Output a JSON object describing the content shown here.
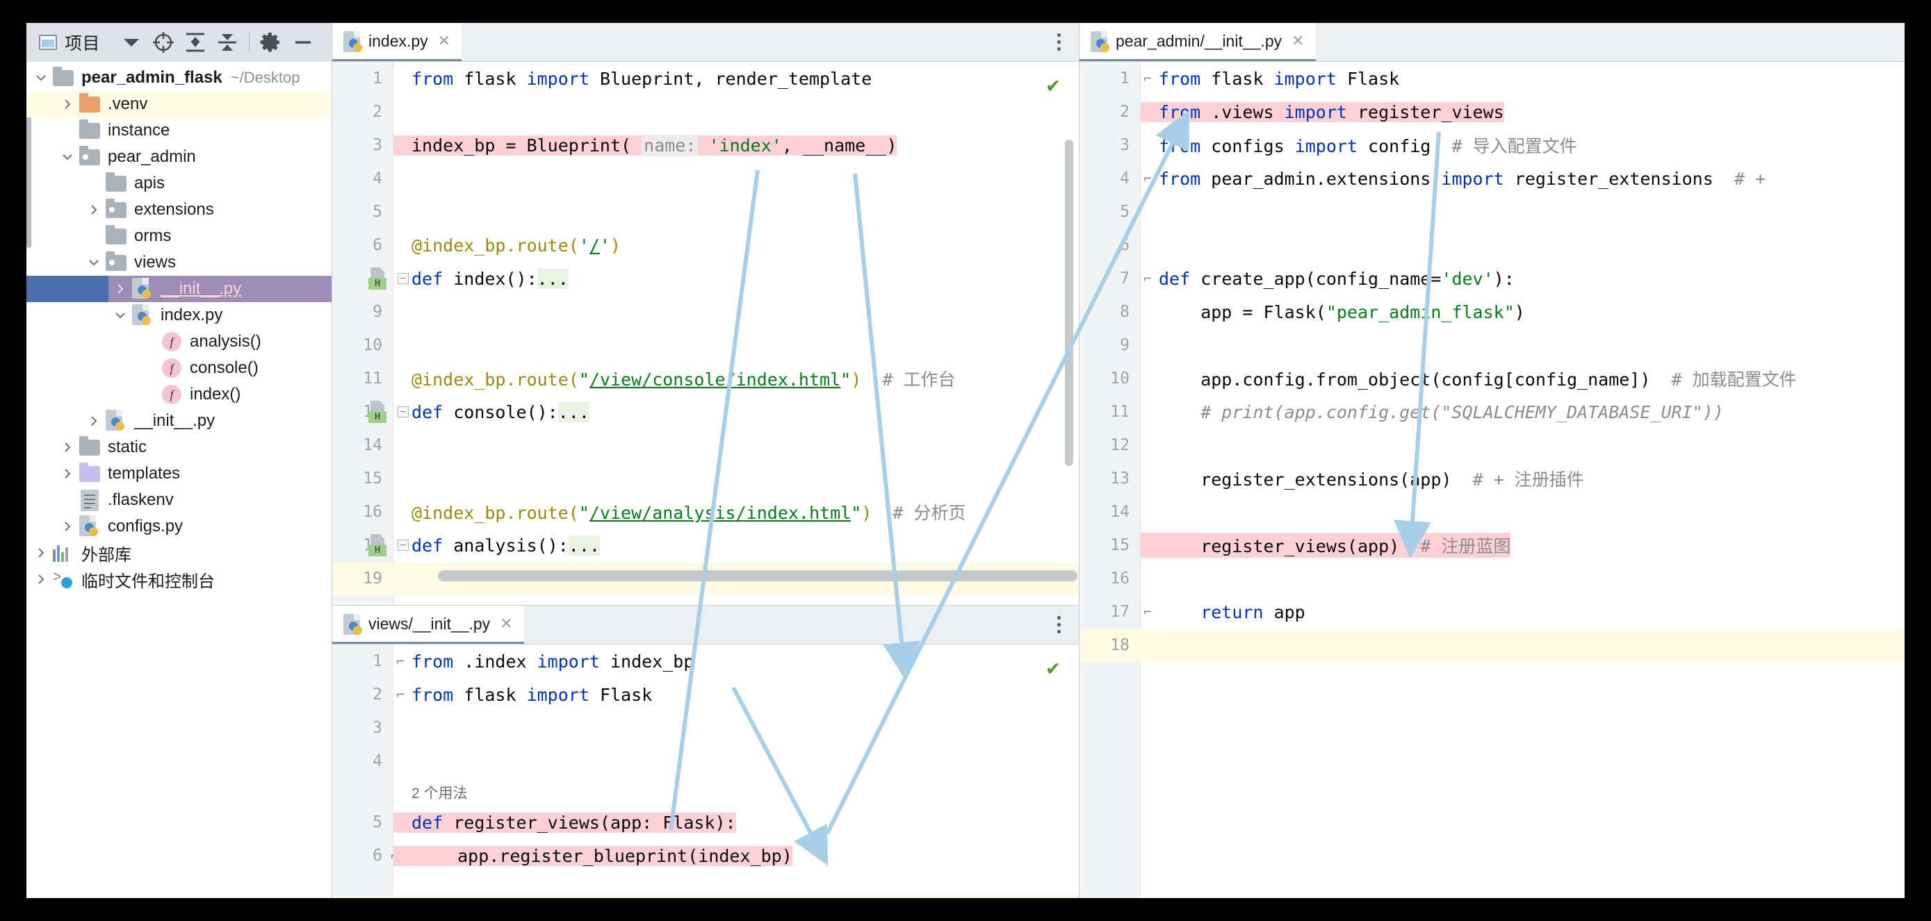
{
  "sidebar": {
    "toolbar": {
      "title": "项目",
      "buttons": [
        {
          "name": "project-dropdown",
          "icon": "chevron-down-icon"
        },
        {
          "name": "locate-file",
          "icon": "crosshair-icon"
        },
        {
          "name": "expand-all",
          "icon": "expand-all-icon"
        },
        {
          "name": "collapse-all",
          "icon": "collapse-all-icon"
        },
        {
          "name": "settings",
          "icon": "gear-icon"
        },
        {
          "name": "hide-panel",
          "icon": "minus-icon"
        }
      ]
    },
    "tree": [
      {
        "label": "pear_admin_flask",
        "note": "~/Desktop",
        "icon": "folder-icon",
        "indent": 0,
        "arrow": "down",
        "bold": true
      },
      {
        "label": ".venv",
        "icon": "folder-orange-icon",
        "indent": 1,
        "arrow": "right",
        "highlight": "venv"
      },
      {
        "label": "instance",
        "icon": "folder-icon",
        "indent": 1,
        "arrow": "none"
      },
      {
        "label": "pear_admin",
        "icon": "folder-module-icon",
        "indent": 1,
        "arrow": "down"
      },
      {
        "label": "apis",
        "icon": "folder-icon",
        "indent": 2,
        "arrow": "none"
      },
      {
        "label": "extensions",
        "icon": "folder-module-icon",
        "indent": 2,
        "arrow": "right"
      },
      {
        "label": "orms",
        "icon": "folder-icon",
        "indent": 2,
        "arrow": "none"
      },
      {
        "label": "views",
        "icon": "folder-module-icon",
        "indent": 2,
        "arrow": "down"
      },
      {
        "label": "__init__.py",
        "icon": "python-file-icon",
        "indent": 3,
        "arrow": "right",
        "selected": true
      },
      {
        "label": "index.py",
        "icon": "python-file-icon",
        "indent": 3,
        "arrow": "down"
      },
      {
        "label": "analysis()",
        "icon": "function-icon",
        "indent": 4,
        "arrow": "none"
      },
      {
        "label": "console()",
        "icon": "function-icon",
        "indent": 4,
        "arrow": "none"
      },
      {
        "label": "index()",
        "icon": "function-icon",
        "indent": 4,
        "arrow": "none"
      },
      {
        "label": "__init__.py",
        "icon": "python-file-icon",
        "indent": 2,
        "arrow": "right"
      },
      {
        "label": "static",
        "icon": "folder-icon",
        "indent": 1,
        "arrow": "right"
      },
      {
        "label": "templates",
        "icon": "folder-purple-icon",
        "indent": 1,
        "arrow": "right"
      },
      {
        "label": ".flaskenv",
        "icon": "text-file-icon",
        "indent": 1,
        "arrow": "none"
      },
      {
        "label": "configs.py",
        "icon": "python-file-icon",
        "indent": 1,
        "arrow": "right"
      },
      {
        "label": "外部库",
        "icon": "library-icon",
        "indent": 0,
        "arrow": "right"
      },
      {
        "label": "临时文件和控制台",
        "icon": "scratches-icon",
        "indent": 0,
        "arrow": "right"
      }
    ]
  },
  "editors": {
    "index_py": {
      "tab": {
        "label": "index.py",
        "icon": "python-file-icon",
        "close": "✕"
      },
      "status_icon": "inspection-ok-icon",
      "lines": [
        {
          "num": "1",
          "tokens": [
            {
              "t": "from ",
              "c": "k"
            },
            {
              "t": "flask ",
              "c": "plain"
            },
            {
              "t": "import ",
              "c": "k"
            },
            {
              "t": "Blueprint, render_template",
              "c": "plain"
            }
          ]
        },
        {
          "num": "2",
          "tokens": []
        },
        {
          "num": "3",
          "hl": "pink",
          "tokens": [
            {
              "t": "index_bp = Blueprint( ",
              "c": "plain"
            },
            {
              "t": "name:",
              "c": "param"
            },
            {
              "t": " ",
              "c": "plain"
            },
            {
              "t": "'index'",
              "c": "s"
            },
            {
              "t": ", __name__)",
              "c": "plain"
            }
          ]
        },
        {
          "num": "4",
          "tokens": []
        },
        {
          "num": "5",
          "tokens": []
        },
        {
          "num": "6",
          "tokens": [
            {
              "t": "@index_bp.route(",
              "c": "dec"
            },
            {
              "t": "'",
              "c": "s"
            },
            {
              "t": "/",
              "c": "lnk"
            },
            {
              "t": "'",
              "c": "s"
            },
            {
              "t": ")",
              "c": "dec"
            }
          ]
        },
        {
          "num": "7",
          "gutter": "run",
          "fold": true,
          "tokens": [
            {
              "t": "def ",
              "c": "k"
            },
            {
              "t": "index():",
              "c": "plain"
            },
            {
              "t": "...",
              "c": "ellipsis"
            }
          ]
        },
        {
          "num": "9",
          "tokens": []
        },
        {
          "num": "10",
          "tokens": []
        },
        {
          "num": "11",
          "tokens": [
            {
              "t": "@index_bp.route(",
              "c": "dec"
            },
            {
              "t": "\"",
              "c": "s"
            },
            {
              "t": "/view/console/index.html",
              "c": "lnk"
            },
            {
              "t": "\"",
              "c": "s"
            },
            {
              "t": ")",
              "c": "dec"
            },
            {
              "t": "  # 工作台",
              "c": "cm"
            }
          ]
        },
        {
          "num": "12",
          "gutter": "run",
          "fold": true,
          "tokens": [
            {
              "t": "def ",
              "c": "k"
            },
            {
              "t": "console():",
              "c": "plain"
            },
            {
              "t": "...",
              "c": "ellipsis"
            }
          ]
        },
        {
          "num": "14",
          "tokens": []
        },
        {
          "num": "15",
          "tokens": []
        },
        {
          "num": "16",
          "tokens": [
            {
              "t": "@index_bp.route(",
              "c": "dec"
            },
            {
              "t": "\"",
              "c": "s"
            },
            {
              "t": "/view/analysis/index.html",
              "c": "lnk"
            },
            {
              "t": "\"",
              "c": "s"
            },
            {
              "t": ")",
              "c": "dec"
            },
            {
              "t": "  # 分析页",
              "c": "cm"
            }
          ]
        },
        {
          "num": "17",
          "gutter": "run",
          "fold": true,
          "tokens": [
            {
              "t": "def ",
              "c": "k"
            },
            {
              "t": "analysis():",
              "c": "plain"
            },
            {
              "t": "...",
              "c": "ellipsis"
            }
          ]
        },
        {
          "num": "19",
          "cur": true,
          "scrollbar": true,
          "tokens": []
        }
      ]
    },
    "views_init_py": {
      "tab": {
        "label": "views/__init__.py",
        "icon": "python-file-icon",
        "close": "✕"
      },
      "status_icon": "inspection-ok-icon",
      "usage_note": "2 个用法",
      "lines": [
        {
          "num": "1",
          "brace": "top",
          "tokens": [
            {
              "t": "from ",
              "c": "k"
            },
            {
              "t": ".index ",
              "c": "plain"
            },
            {
              "t": "import ",
              "c": "k"
            },
            {
              "t": "index_bp",
              "c": "plain"
            }
          ]
        },
        {
          "num": "2",
          "brace": "bot",
          "tokens": [
            {
              "t": "from ",
              "c": "k"
            },
            {
              "t": "flask ",
              "c": "plain"
            },
            {
              "t": "import ",
              "c": "k"
            },
            {
              "t": "Flask",
              "c": "plain"
            }
          ]
        },
        {
          "num": "3",
          "tokens": []
        },
        {
          "num": "4",
          "tokens": []
        },
        {
          "num": "5",
          "hl": "pink",
          "brace": "top",
          "tokens": [
            {
              "t": "def ",
              "c": "k"
            },
            {
              "t": "register_views(app: Flask):",
              "c": "plain"
            }
          ]
        },
        {
          "num": "6",
          "hl": "pink",
          "bulb": true,
          "tokens": [
            {
              "t": "    app.register_blueprint(index_bp)",
              "c": "plain"
            }
          ]
        }
      ]
    },
    "pear_admin_init_py": {
      "tab": {
        "label": "pear_admin/__init__.py",
        "icon": "python-file-icon",
        "close": "✕"
      },
      "lines": [
        {
          "num": "1",
          "brace": "top",
          "tokens": [
            {
              "t": "from ",
              "c": "k"
            },
            {
              "t": "flask ",
              "c": "plain"
            },
            {
              "t": "import ",
              "c": "k"
            },
            {
              "t": "Flask",
              "c": "plain"
            }
          ]
        },
        {
          "num": "2",
          "hl": "pink",
          "tokens": [
            {
              "t": "from ",
              "c": "k"
            },
            {
              "t": ".views ",
              "c": "plain"
            },
            {
              "t": "import ",
              "c": "k"
            },
            {
              "t": "register_views",
              "c": "plain"
            }
          ]
        },
        {
          "num": "3",
          "tokens": [
            {
              "t": "from ",
              "c": "k"
            },
            {
              "t": "configs ",
              "c": "plain"
            },
            {
              "t": "import ",
              "c": "k"
            },
            {
              "t": "config",
              "c": "plain"
            },
            {
              "t": "  # 导入配置文件",
              "c": "cm"
            }
          ]
        },
        {
          "num": "4",
          "brace": "bot",
          "tokens": [
            {
              "t": "from ",
              "c": "k"
            },
            {
              "t": "pear_admin.extensions ",
              "c": "plain"
            },
            {
              "t": "import ",
              "c": "k"
            },
            {
              "t": "register_extensions",
              "c": "plain"
            },
            {
              "t": "  # +",
              "c": "cm"
            }
          ]
        },
        {
          "num": "5",
          "tokens": []
        },
        {
          "num": "6",
          "tokens": []
        },
        {
          "num": "7",
          "brace": "top",
          "tokens": [
            {
              "t": "def ",
              "c": "k"
            },
            {
              "t": "create_app(config_name=",
              "c": "plain"
            },
            {
              "t": "'dev'",
              "c": "s"
            },
            {
              "t": "):",
              "c": "plain"
            }
          ]
        },
        {
          "num": "8",
          "tokens": [
            {
              "t": "    app = Flask(",
              "c": "plain"
            },
            {
              "t": "\"pear_admin_flask\"",
              "c": "s"
            },
            {
              "t": ")",
              "c": "plain"
            }
          ]
        },
        {
          "num": "9",
          "tokens": []
        },
        {
          "num": "10",
          "tokens": [
            {
              "t": "    app.config.from_object(config[config_name])",
              "c": "plain"
            },
            {
              "t": "  # 加载配置文件",
              "c": "cm"
            }
          ]
        },
        {
          "num": "11",
          "tokens": [
            {
              "t": "    # print(app.config.get(\"SQLALCHEMY_DATABASE_URI\"))",
              "c": "cmi"
            }
          ]
        },
        {
          "num": "12",
          "tokens": []
        },
        {
          "num": "13",
          "tokens": [
            {
              "t": "    register_extensions(app)",
              "c": "plain"
            },
            {
              "t": "  # + 注册插件",
              "c": "cm"
            }
          ]
        },
        {
          "num": "14",
          "tokens": []
        },
        {
          "num": "15",
          "hl": "pink",
          "tokens": [
            {
              "t": "    register_views(app)",
              "c": "plain"
            },
            {
              "t": "  # 注册蓝图",
              "c": "cm"
            }
          ]
        },
        {
          "num": "16",
          "tokens": []
        },
        {
          "num": "17",
          "brace": "bot",
          "tokens": [
            {
              "t": "    return ",
              "c": "k"
            },
            {
              "t": "app",
              "c": "plain"
            }
          ]
        },
        {
          "num": "18",
          "cur": true,
          "tokens": []
        }
      ]
    }
  },
  "colors": {
    "selection_blue": "#4b6eaf",
    "highlight_pink": "#ffd0d5",
    "highlight_green": "#e9f5e3",
    "current_line": "#fdfbe4",
    "arrow_blue": "#a7d0e8",
    "keyword": "#0033b3",
    "string": "#067d17",
    "comment": "#8c8c8c",
    "decorator": "#9e880d"
  }
}
